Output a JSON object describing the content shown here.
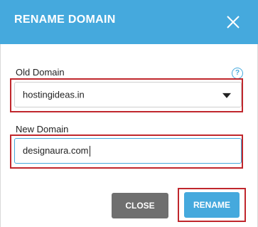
{
  "dialog": {
    "title": "RENAME DOMAIN",
    "close_icon": "close-icon"
  },
  "old_domain": {
    "label": "Old Domain",
    "selected": "hostingideas.in",
    "help_icon": "question-circle-icon"
  },
  "new_domain": {
    "label": "New Domain",
    "value": "designaura.com"
  },
  "buttons": {
    "close": "CLOSE",
    "rename": "RENAME"
  },
  "colors": {
    "header": "#45a9dd",
    "highlight": "#c0272d",
    "close_button": "#6f6f6f",
    "rename_button": "#45a9dd"
  }
}
